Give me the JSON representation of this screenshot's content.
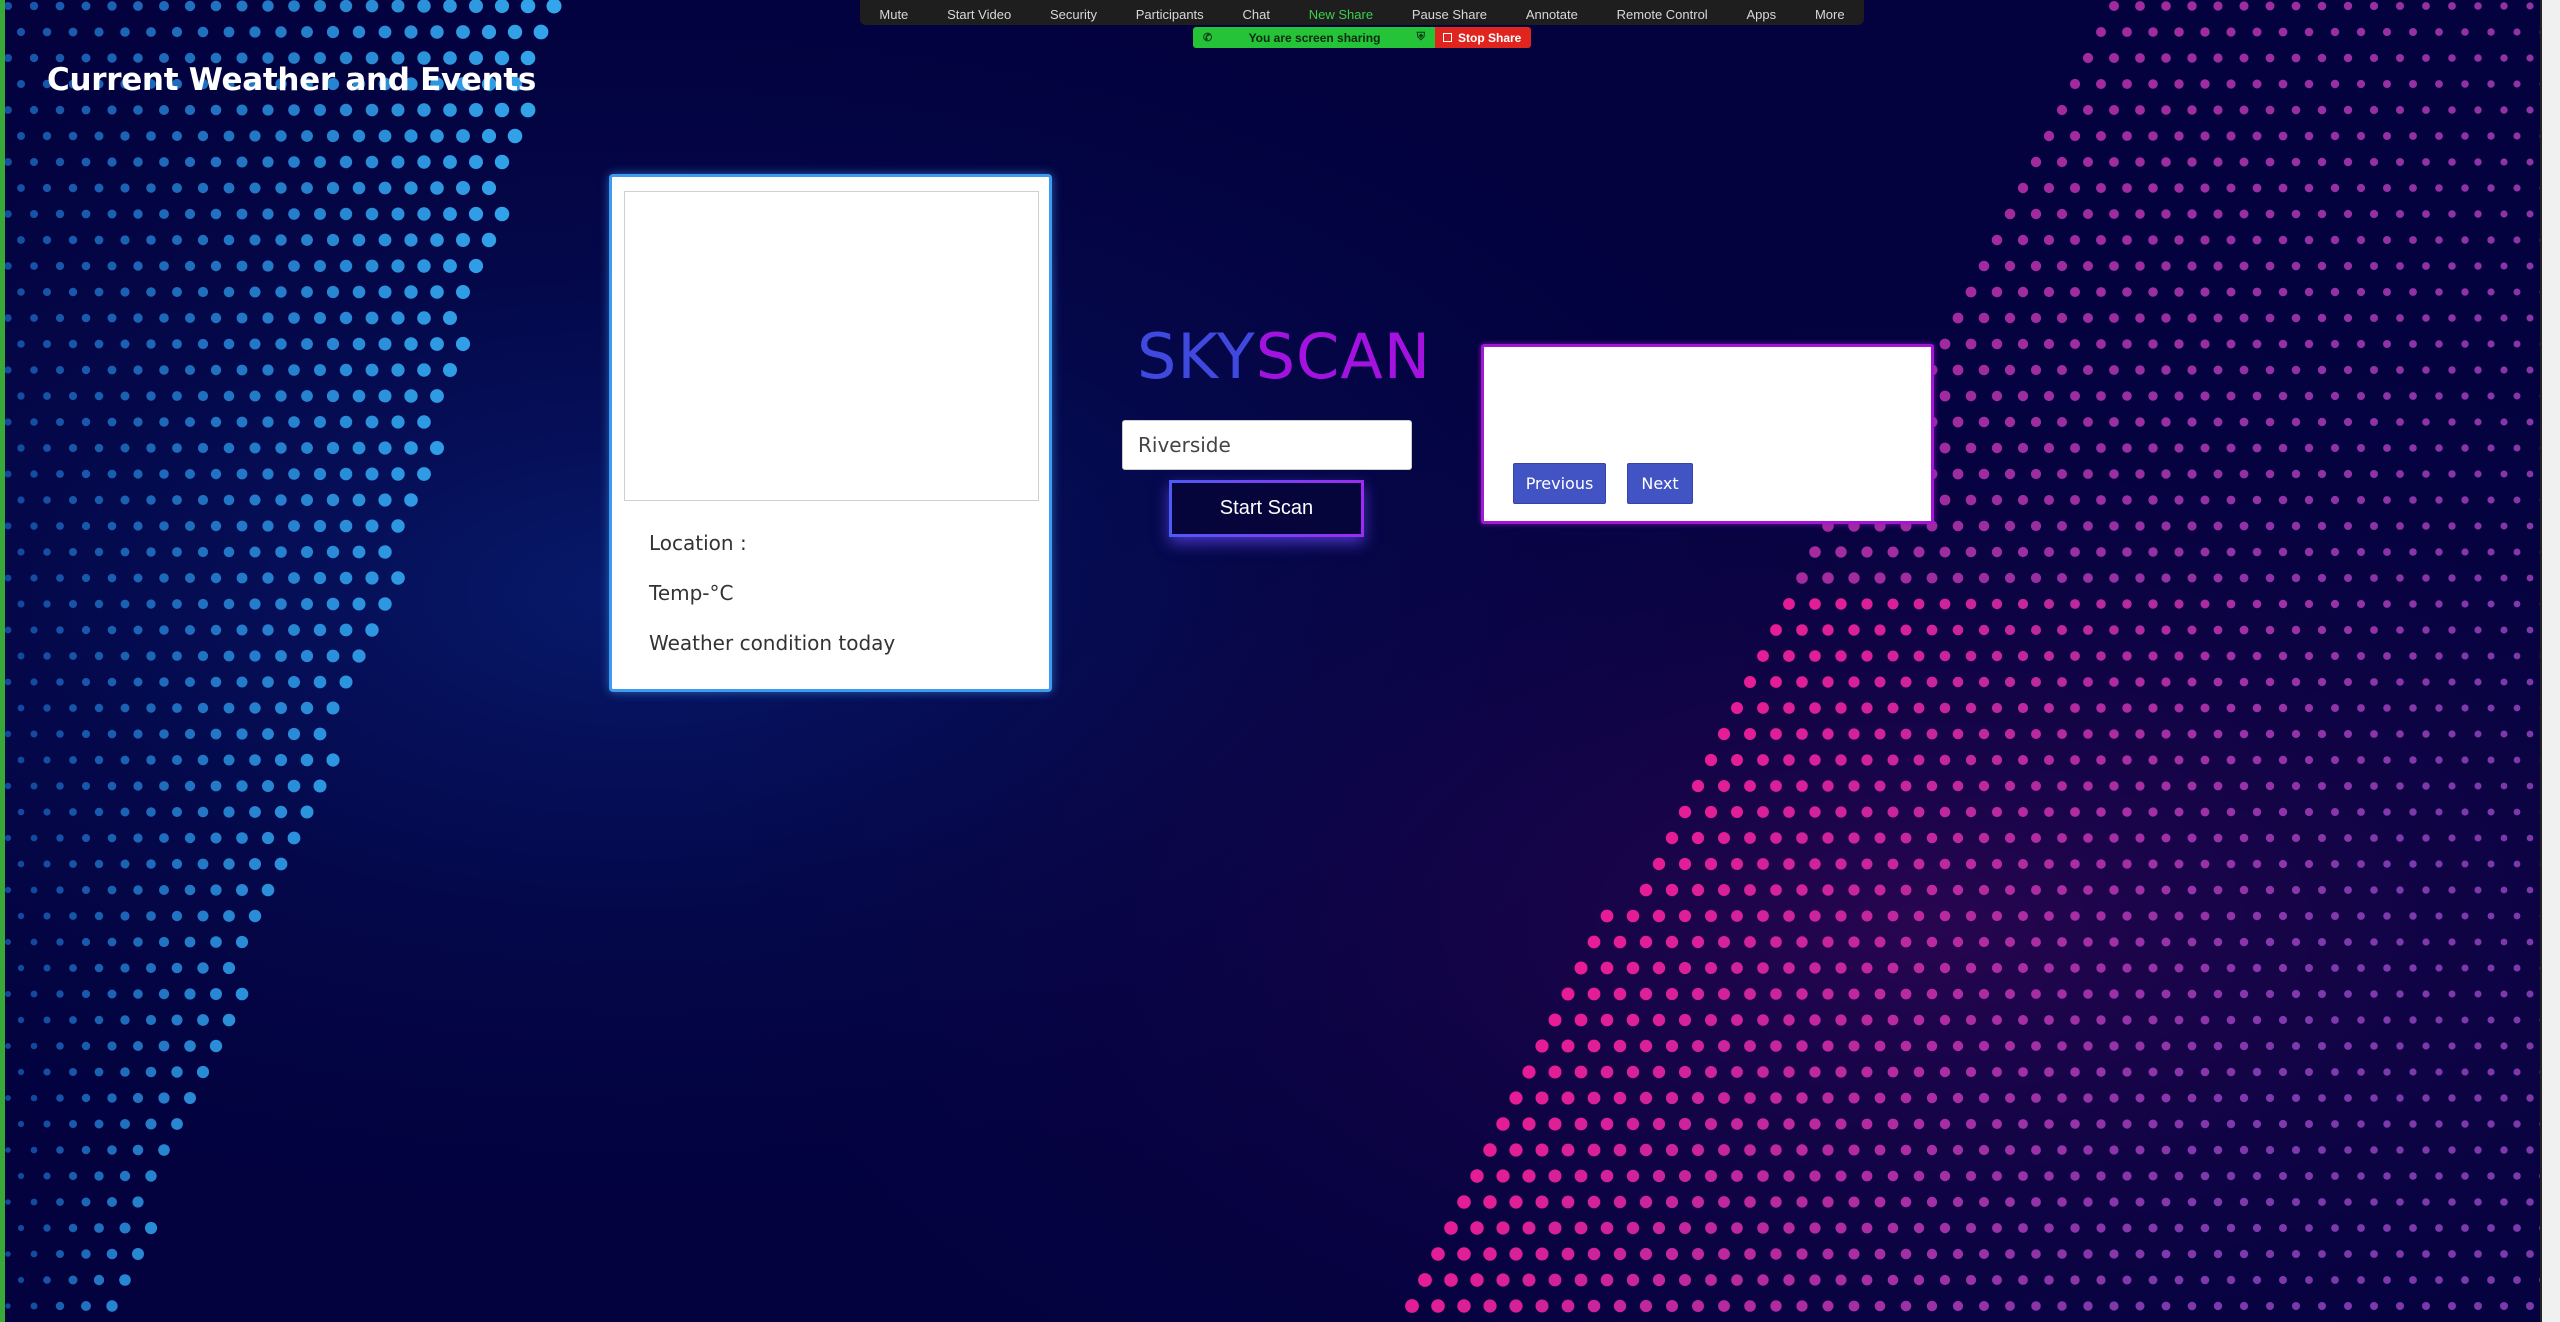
{
  "zoom_toolbar": {
    "items": [
      {
        "label": "Mute",
        "active": false
      },
      {
        "label": "Start Video",
        "active": false
      },
      {
        "label": "Security",
        "active": false
      },
      {
        "label": "Participants",
        "active": false
      },
      {
        "label": "Chat",
        "active": false
      },
      {
        "label": "New Share",
        "active": true
      },
      {
        "label": "Pause Share",
        "active": false
      },
      {
        "label": "Annotate",
        "active": false
      },
      {
        "label": "Remote Control",
        "active": false
      },
      {
        "label": "Apps",
        "active": false
      },
      {
        "label": "More",
        "active": false
      }
    ],
    "sharing_status": "You are screen sharing",
    "stop_share_label": "Stop Share"
  },
  "page": {
    "title": "Current Weather and Events"
  },
  "weather": {
    "location_label": "Location :",
    "temp_label": "Temp-°C",
    "condition_label": "Weather condition today"
  },
  "search": {
    "logo_part1": "SKY",
    "logo_part2": "SCAN",
    "input_value": "Riverside",
    "scan_button": "Start Scan"
  },
  "events": {
    "previous_label": "Previous",
    "next_label": "Next"
  },
  "colors": {
    "background": "#03023f",
    "blue_dots": "#1f8ff5",
    "pink_dots": "#ff1f9e",
    "purple_dots": "#8a3fb8",
    "logo_blue": "#3f49de",
    "logo_purple": "#a412e0",
    "weather_border": "#3d9bf2",
    "events_border": "#a318d4",
    "event_button": "#4254c4",
    "share_green": "#24c338",
    "stop_red": "#e0251f"
  }
}
